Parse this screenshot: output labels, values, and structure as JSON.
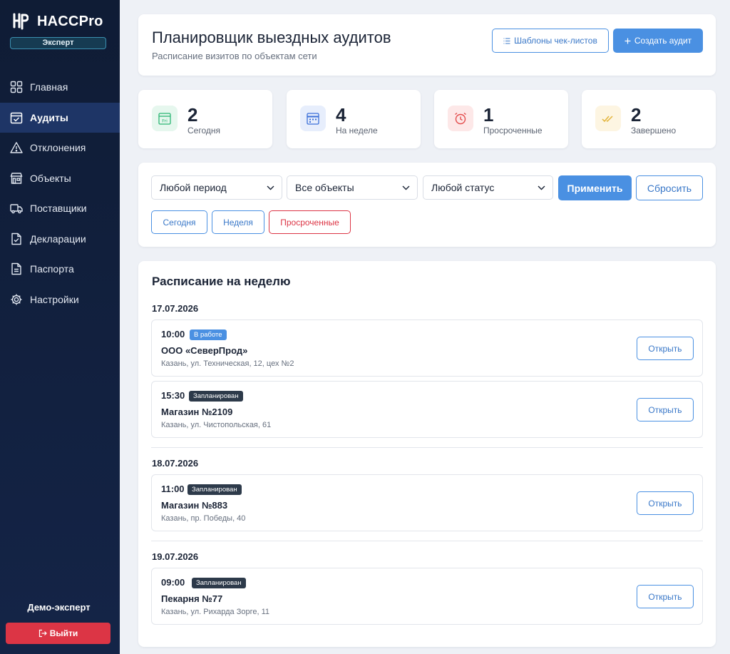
{
  "app": {
    "name": "HACCPro",
    "role": "Эксперт"
  },
  "sidebar": {
    "items": [
      {
        "label": "Главная",
        "icon": "grid-icon"
      },
      {
        "label": "Аудиты",
        "icon": "calendar-check-icon"
      },
      {
        "label": "Отклонения",
        "icon": "warning-icon"
      },
      {
        "label": "Объекты",
        "icon": "building-icon"
      },
      {
        "label": "Поставщики",
        "icon": "truck-icon"
      },
      {
        "label": "Декларации",
        "icon": "document-check-icon"
      },
      {
        "label": "Паспорта",
        "icon": "document-icon"
      },
      {
        "label": "Настройки",
        "icon": "gear-icon"
      }
    ],
    "active_index": 1,
    "user_name": "Демо-эксперт",
    "logout_label": "Выйти"
  },
  "header": {
    "title": "Планировщик выездных аудитов",
    "subtitle": "Расписание визитов по объектам сети",
    "templates_label": "Шаблоны чек-листов",
    "create_label": "Создать аудит"
  },
  "stats": [
    {
      "value": "2",
      "label": "Сегодня",
      "icon": "calendar-day-icon",
      "icon_text": "Fri",
      "color": "#2bb673",
      "bg": "#e6f7ee"
    },
    {
      "value": "4",
      "label": "На неделе",
      "icon": "calendar-week-icon",
      "color": "#3b6fd8",
      "bg": "#e7eefc"
    },
    {
      "value": "1",
      "label": "Просроченные",
      "icon": "alarm-clock-icon",
      "color": "#e34c4c",
      "bg": "#fde8e8"
    },
    {
      "value": "2",
      "label": "Завершено",
      "icon": "double-check-icon",
      "color": "#e3b43a",
      "bg": "#fdf5e2"
    }
  ],
  "filters": {
    "period": "Любой период",
    "objects": "Все объекты",
    "status": "Любой статус",
    "apply_label": "Применить",
    "reset_label": "Сбросить",
    "chips": [
      "Сегодня",
      "Неделя",
      "Просроченные"
    ]
  },
  "schedule": {
    "title": "Расписание на неделю",
    "open_label": "Открыть",
    "days": [
      {
        "date": "17.07.2026",
        "audits": [
          {
            "time": "10:00",
            "status": "В работе",
            "name": "ООО «СеверПрод»",
            "address": "Казань, ул. Техническая, 12, цех №2"
          },
          {
            "time": "15:30",
            "status": "Запланирован",
            "name": "Магазин №2109",
            "address": "Казань, ул. Чистопольская, 61"
          }
        ]
      },
      {
        "date": "18.07.2026",
        "audits": [
          {
            "time": "11:00",
            "status": "Запланирован",
            "name": "Магазин №883",
            "address": "Казань, пр. Победы, 40"
          }
        ]
      },
      {
        "date": "19.07.2026",
        "audits": [
          {
            "time": "09:00",
            "status": "Запланирован",
            "name": "Пекарня №77",
            "address": "Казань, ул. Рихарда Зорге, 11"
          }
        ]
      }
    ]
  }
}
